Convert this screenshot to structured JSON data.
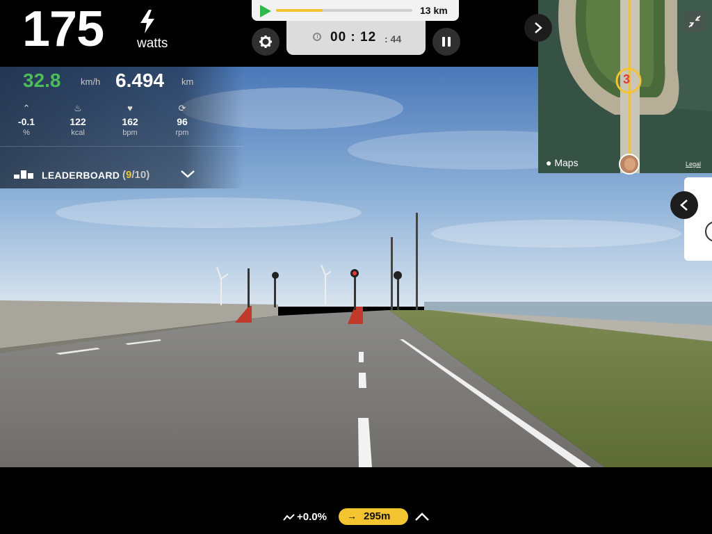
{
  "power": {
    "value": "175",
    "unit": "watts"
  },
  "route": {
    "total_distance": "13 km",
    "progress_percent": 34
  },
  "timer": {
    "hours_minutes": "00 : 12",
    "seconds": ": 44"
  },
  "stats": {
    "speed": {
      "value": "32.8",
      "unit": "km/h"
    },
    "distance": {
      "value": "6.494",
      "unit": "km"
    },
    "metrics": [
      {
        "icon": "grade-icon",
        "value": "-0.1",
        "unit": "%"
      },
      {
        "icon": "flame-icon",
        "value": "122",
        "unit": "kcal"
      },
      {
        "icon": "heart-icon",
        "value": "162",
        "unit": "bpm"
      },
      {
        "icon": "cadence-icon",
        "value": "96",
        "unit": "rpm"
      }
    ]
  },
  "leaderboard": {
    "label": "LEADERBOARD",
    "open": "(",
    "position": "9",
    "total": "/10",
    "close": ")"
  },
  "map": {
    "brand": "Maps",
    "legal": "Legal",
    "marker_label": "3"
  },
  "bottom": {
    "grade": "+0.0%",
    "next_arrow": "→",
    "next_distance": "295m"
  },
  "colors": {
    "accent_yellow": "#f4c430",
    "speed_green": "#4cbb5c",
    "play_green": "#2db84a"
  }
}
